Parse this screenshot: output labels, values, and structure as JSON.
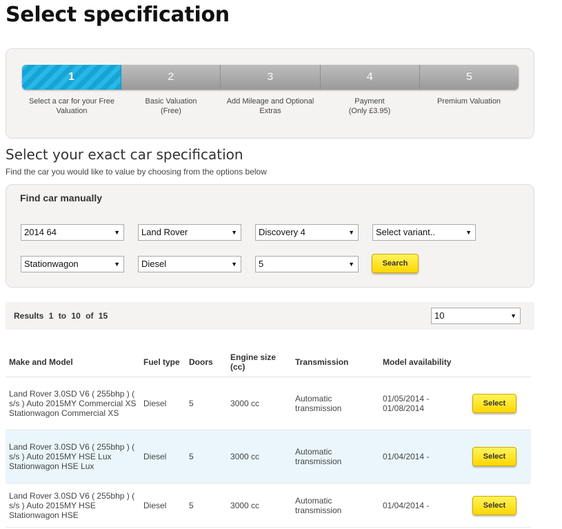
{
  "page": {
    "title": "Select specification"
  },
  "progress": {
    "steps": [
      {
        "number": "1",
        "label": "Select a car for your Free\nValuation"
      },
      {
        "number": "2",
        "label": "Basic Valuation\n(Free)"
      },
      {
        "number": "3",
        "label": "Add Mileage and Optional\nExtras"
      },
      {
        "number": "4",
        "label": "Payment\n(Only £3.95)"
      },
      {
        "number": "5",
        "label": "Premium Valuation"
      }
    ],
    "active_step": 1,
    "active_color": "#1aa9da"
  },
  "specification": {
    "heading": "Select your exact car specification",
    "subheading": "Find the car you would like to value by choosing from the options below"
  },
  "find_manual": {
    "title": "Find car manually",
    "year": "2014 64",
    "make": "Land Rover",
    "model": "Discovery 4",
    "variant": "Select variant..",
    "body_type": "Stationwagon",
    "fuel": "Diesel",
    "doors": "5",
    "search_label": "Search"
  },
  "results": {
    "label": "Results",
    "from": "1",
    "to_word": "to",
    "to": "10",
    "of_word": "of",
    "total": "15",
    "per_page": "10"
  },
  "table": {
    "headers": {
      "make_model": "Make and Model",
      "fuel": "Fuel type",
      "doors": "Doors",
      "engine": "Engine size (cc)",
      "transmission": "Transmission",
      "availability": "Model availability"
    },
    "rows": [
      {
        "make_model": "Land Rover 3.0SD V6 ( 255bhp ) ( s/s ) Auto 2015MY Commercial XS Stationwagon Commercial XS",
        "fuel": "Diesel",
        "doors": "5",
        "engine": "3000 cc",
        "transmission": "Automatic transmission",
        "availability": "01/05/2014 - 01/08/2014",
        "button": "Select"
      },
      {
        "make_model": "Land Rover 3.0SD V6 ( 255bhp ) ( s/s ) Auto 2015MY HSE Lux Stationwagon HSE Lux",
        "fuel": "Diesel",
        "doors": "5",
        "engine": "3000 cc",
        "transmission": "Automatic transmission",
        "availability": "01/04/2014 -",
        "button": "Select"
      },
      {
        "make_model": "Land Rover 3.0SD V6 ( 255bhp ) ( s/s ) Auto 2015MY HSE Stationwagon HSE",
        "fuel": "Diesel",
        "doors": "5",
        "engine": "3000 cc",
        "transmission": "Automatic transmission",
        "availability": "01/04/2014 -",
        "button": "Select"
      }
    ]
  },
  "colors": {
    "button_yellow": "#ffd700",
    "panel_bg": "#f4f3f2",
    "alt_row_bg": "#eaf6fb"
  }
}
